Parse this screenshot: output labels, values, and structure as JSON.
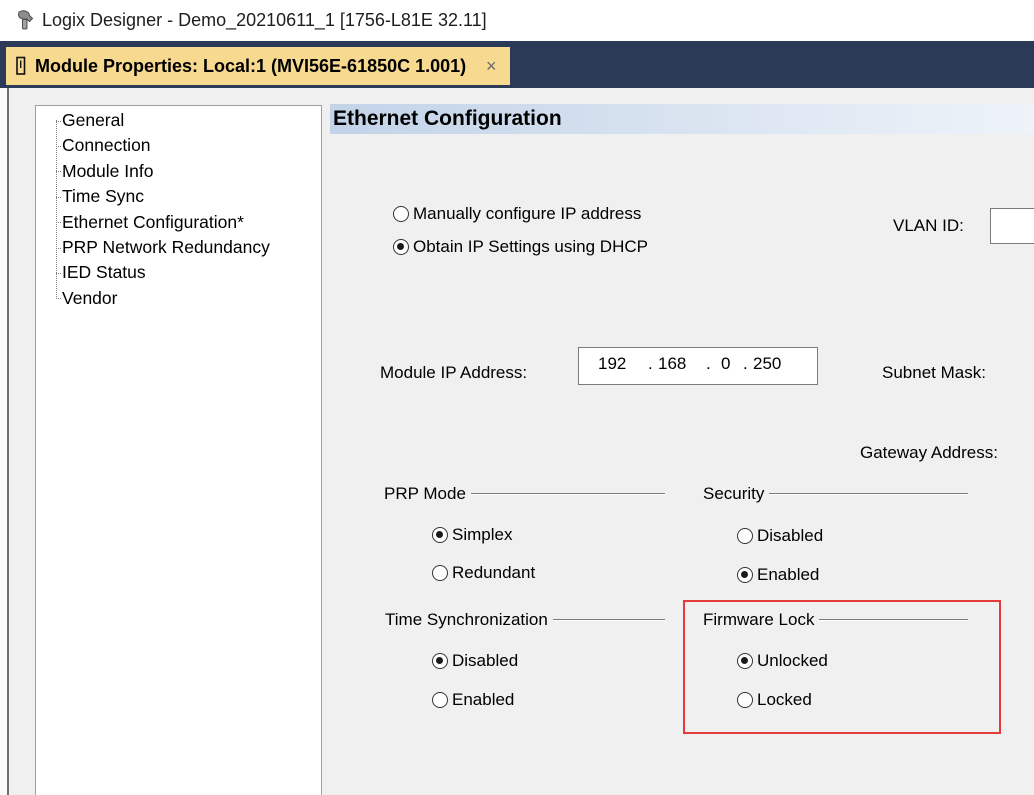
{
  "window": {
    "title": "Logix Designer - Demo_20210611_1 [1756-L81E 32.11]",
    "icon": "logix-designer-icon"
  },
  "tab": {
    "label": "Module Properties: Local:1 (MVI56E-61850C 1.001)",
    "icon": "module-properties-icon",
    "close_glyph": "×"
  },
  "tree": {
    "items": [
      {
        "label": "General"
      },
      {
        "label": "Connection"
      },
      {
        "label": "Module Info"
      },
      {
        "label": "Time Sync"
      },
      {
        "label": "Ethernet Configuration*"
      },
      {
        "label": "PRP Network Redundancy"
      },
      {
        "label": "IED Status"
      },
      {
        "label": "Vendor"
      }
    ]
  },
  "panel": {
    "title": "Ethernet Configuration",
    "ip_mode": {
      "options": [
        {
          "label": "Manually configure IP address",
          "selected": false
        },
        {
          "label": "Obtain IP Settings using DHCP",
          "selected": true
        }
      ]
    },
    "vlan": {
      "label": "VLAN ID:",
      "value": ""
    },
    "module_ip": {
      "label": "Module IP Address:",
      "octets": [
        "192",
        "168",
        "0",
        "250"
      ],
      "separator": "."
    },
    "subnet_mask": {
      "label": "Subnet Mask:"
    },
    "gateway": {
      "label": "Gateway Address:"
    },
    "prp_mode": {
      "label": "PRP Mode",
      "options": [
        {
          "label": "Simplex",
          "selected": true
        },
        {
          "label": "Redundant",
          "selected": false
        }
      ]
    },
    "security": {
      "label": "Security",
      "options": [
        {
          "label": "Disabled",
          "selected": false
        },
        {
          "label": "Enabled",
          "selected": true
        }
      ]
    },
    "time_sync": {
      "label": "Time Synchronization",
      "options": [
        {
          "label": "Disabled",
          "selected": true
        },
        {
          "label": "Enabled",
          "selected": false
        }
      ]
    },
    "firmware_lock": {
      "label": "Firmware Lock",
      "highlighted": true,
      "options": [
        {
          "label": "Unlocked",
          "selected": true
        },
        {
          "label": "Locked",
          "selected": false
        }
      ]
    }
  },
  "colors": {
    "navy": "#2a3a57",
    "tab": "#f7d990",
    "highlight": "#e53a3a",
    "header_start": "#c3d3e8",
    "header_end": "#eef3f9"
  }
}
